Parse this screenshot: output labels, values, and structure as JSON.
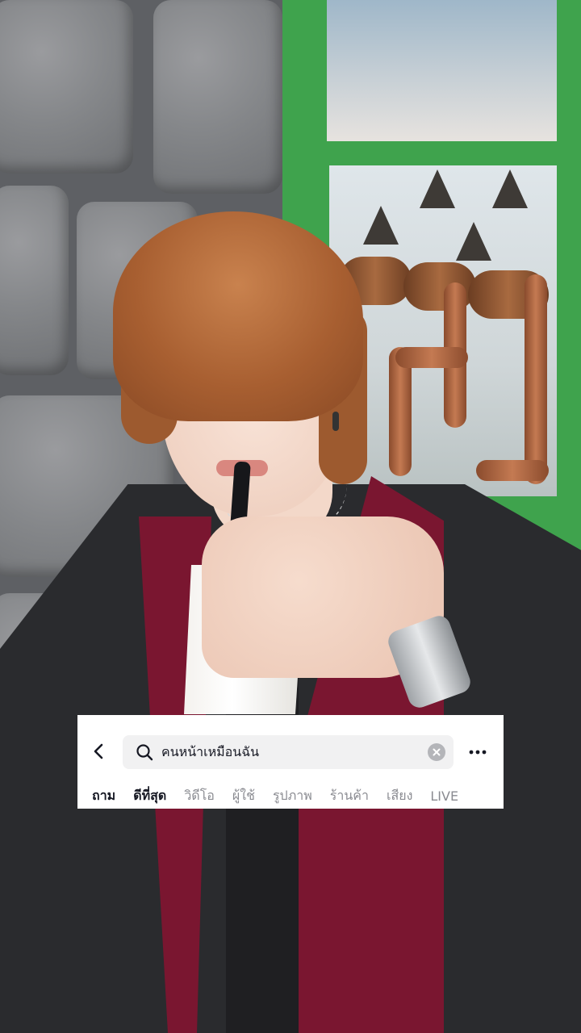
{
  "search": {
    "query": "คนหน้าเหมือนฉัน",
    "back_icon": "chevron-left-icon",
    "search_icon": "search-icon",
    "clear_icon": "clear-circle-icon",
    "more_icon": "more-horizontal-icon"
  },
  "tabs": [
    {
      "label": "ถาม",
      "active": true
    },
    {
      "label": "ดีที่สุด",
      "active": true
    },
    {
      "label": "วิดีโอ",
      "active": false
    },
    {
      "label": "ผู้ใช้",
      "active": false
    },
    {
      "label": "รูปภาพ",
      "active": false
    },
    {
      "label": "ร้านค้า",
      "active": false
    },
    {
      "label": "เสียง",
      "active": false
    },
    {
      "label": "LIVE",
      "active": false
    }
  ],
  "colors": {
    "active_tab": "#161823",
    "inactive_tab": "#8a8b91",
    "search_bg": "#f1f1f2",
    "card_bg": "#ffffff"
  }
}
